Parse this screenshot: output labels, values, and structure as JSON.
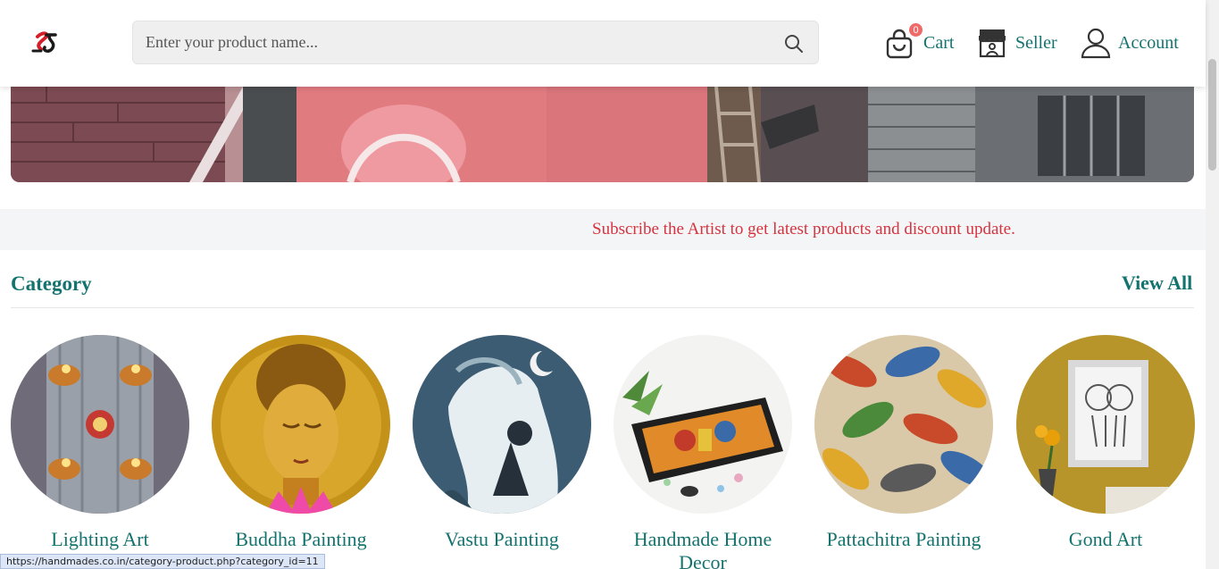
{
  "header": {
    "search": {
      "placeholder": "Enter your product name..."
    },
    "cart": {
      "label": "Cart",
      "count": "0"
    },
    "seller": {
      "label": "Seller"
    },
    "account": {
      "label": "Account"
    }
  },
  "subscribe": {
    "text": "Subscribe the Artist to get latest products and discount update."
  },
  "category": {
    "title": "Category",
    "view_all": "View All",
    "items": [
      {
        "label": "Lighting Art"
      },
      {
        "label": "Buddha Painting"
      },
      {
        "label": "Vastu Painting"
      },
      {
        "label": "Handmade Home Decor"
      },
      {
        "label": "Pattachitra Painting"
      },
      {
        "label": "Gond Art"
      }
    ]
  },
  "status_bar": {
    "url": "https://handmades.co.in/category-product.php?category_id=11"
  },
  "colors": {
    "accent": "#14736f",
    "subscribe_text": "#d5343f",
    "badge": "#f06a6a"
  }
}
